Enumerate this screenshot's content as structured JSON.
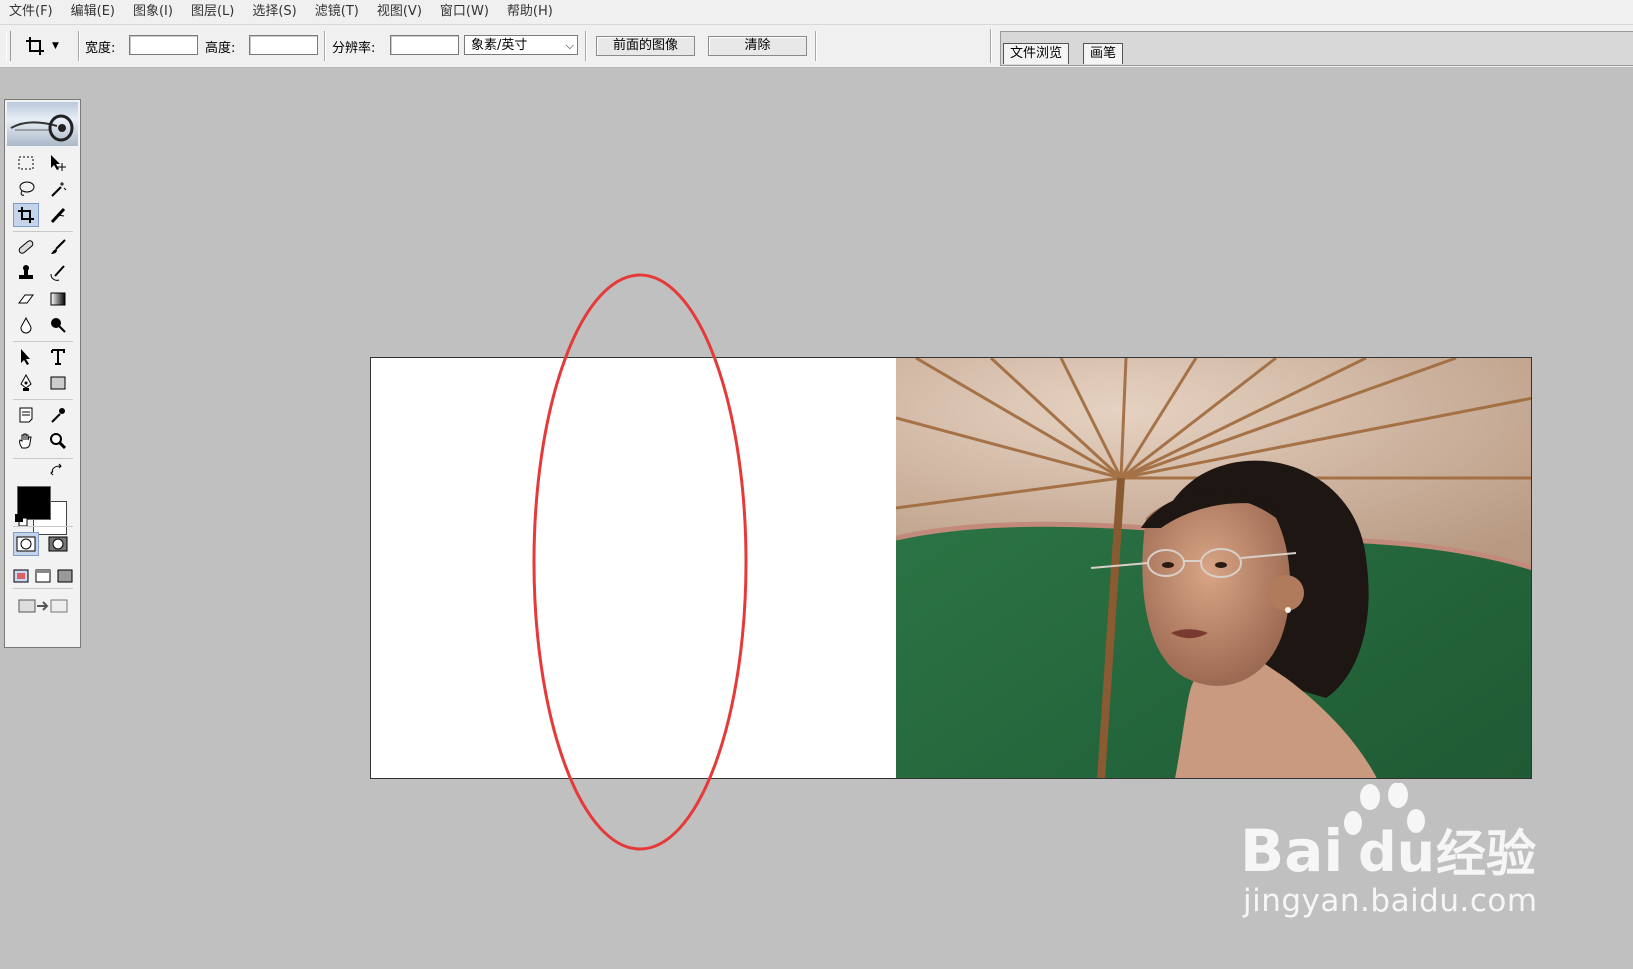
{
  "menu": [
    "文件(F)",
    "编辑(E)",
    "图象(I)",
    "图层(L)",
    "选择(S)",
    "滤镜(T)",
    "视图(V)",
    "窗口(W)",
    "帮助(H)"
  ],
  "options": {
    "width_label": "宽度:",
    "width_value": "",
    "height_label": "高度:",
    "height_value": "",
    "resolution_label": "分辨率:",
    "resolution_value": "",
    "unit_select": "象素/英寸",
    "front_image_button": "前面的图像",
    "clear_button": "清除"
  },
  "palette_tabs": [
    "文件浏览",
    "画笔"
  ],
  "toolbox": {
    "active_tool": "crop-tool",
    "tools": [
      "marquee-tool",
      "move-tool",
      "lasso-tool",
      "magic-wand-tool",
      "crop-tool",
      "slice-tool",
      "healing-brush-tool",
      "brush-tool",
      "clone-stamp-tool",
      "history-brush-tool",
      "eraser-tool",
      "gradient-tool",
      "blur-tool",
      "dodge-tool",
      "path-selection-tool",
      "type-tool",
      "pen-tool",
      "shape-tool",
      "notes-tool",
      "eyedropper-tool",
      "hand-tool",
      "zoom-tool"
    ],
    "foreground_color": "#000000",
    "background_color": "#ffffff"
  },
  "annotation": {
    "shape": "ellipse",
    "color": "#e63a3a"
  },
  "watermark": {
    "domain": "jingyan.baidu.com"
  }
}
